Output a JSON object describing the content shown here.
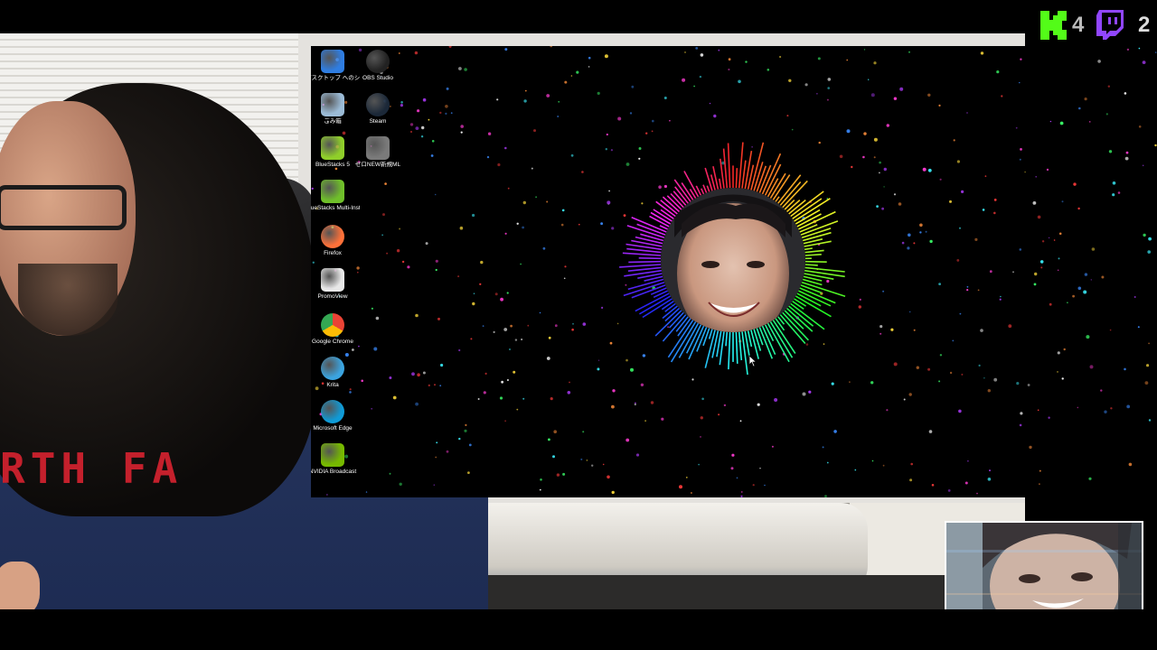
{
  "overlay": {
    "kick_count": "4",
    "twitch_count": "2",
    "kick_color": "#53fc18",
    "twitch_color": "#9146ff"
  },
  "webcam": {
    "hoodie_text": "RTH FA"
  },
  "desktop": {
    "icons": [
      {
        "label": "デスクトップ へのショートカット (OneDri...",
        "icon": "onedrive-icon",
        "color": "#2f7de1"
      },
      {
        "label": "OBS Studio",
        "icon": "obs-icon",
        "color": "#222222"
      },
      {
        "label": "ごみ箱",
        "icon": "recycle-bin-icon",
        "color": "#9bbbd6"
      },
      {
        "label": "Steam",
        "icon": "steam-icon",
        "color": "#1b2838"
      },
      {
        "label": "BlueStacks 5",
        "icon": "bluestacks-icon",
        "color": "#8fce2a"
      },
      {
        "label": "ゼロNEW新規ML",
        "icon": "app-icon",
        "color": "#7a7a7a"
      },
      {
        "label": "BlueStacks Multi-Instance...",
        "icon": "bluestacks-multi-icon",
        "color": "#6fbf2a"
      },
      {
        "label": "Firefox",
        "icon": "firefox-icon",
        "color": "#ff7139"
      },
      {
        "label": "PromoView",
        "icon": "promoview-icon",
        "color": "#e8e8e8"
      },
      {
        "label": "Google Chrome",
        "icon": "chrome-icon",
        "color": "#4285f4"
      },
      {
        "label": "Krita",
        "icon": "krita-icon",
        "color": "#3ba4e0"
      },
      {
        "label": "Microsoft Edge",
        "icon": "edge-icon",
        "color": "#0f9bd7"
      },
      {
        "label": "NVIDIA Broadcast",
        "icon": "nvidia-broadcast-icon",
        "color": "#76b900"
      }
    ]
  }
}
